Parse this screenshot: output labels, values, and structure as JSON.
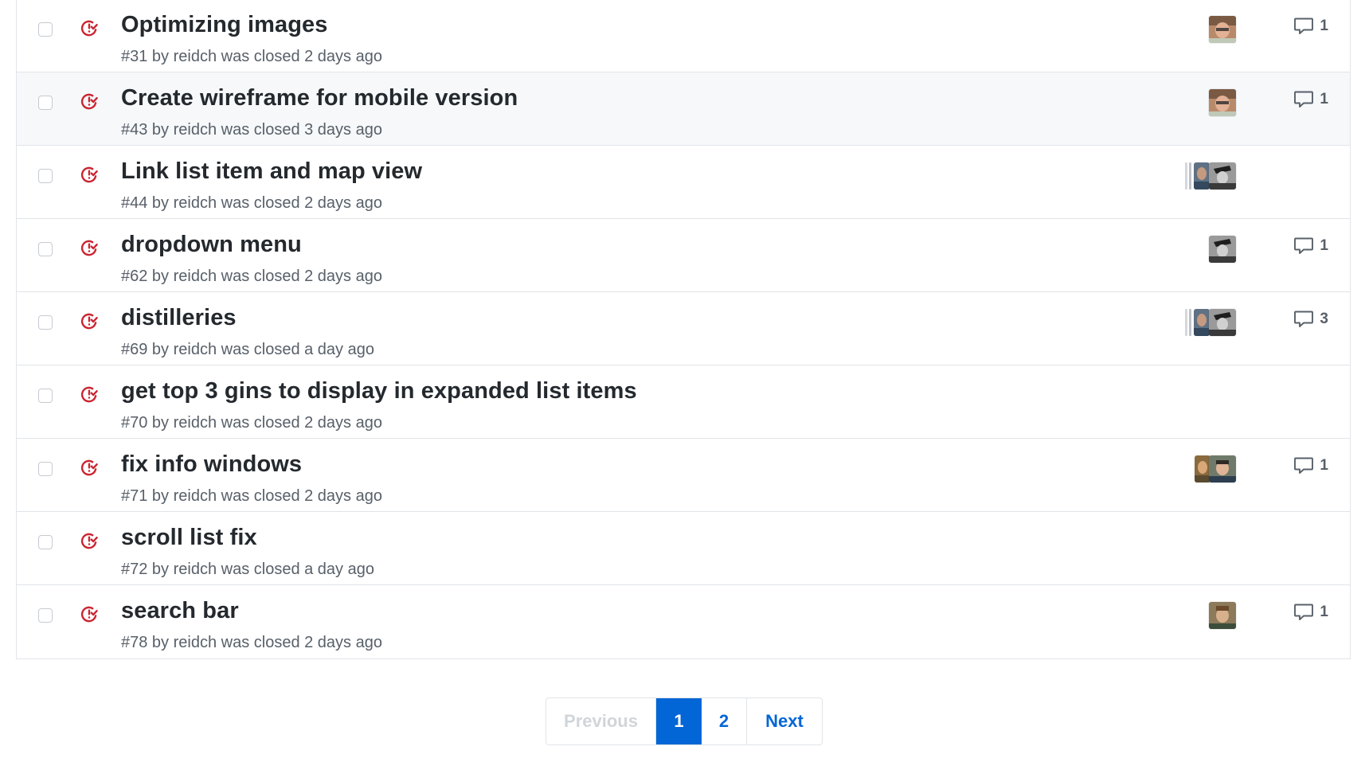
{
  "issues": [
    {
      "title": "Optimizing images",
      "meta": "#31 by reidch was closed 2 days ago",
      "comments": "1"
    },
    {
      "title": "Create wireframe for mobile version",
      "meta": "#43 by reidch was closed 3 days ago",
      "comments": "1"
    },
    {
      "title": "Link list item and map view",
      "meta": "#44 by reidch was closed 2 days ago",
      "comments": ""
    },
    {
      "title": "dropdown menu",
      "meta": "#62 by reidch was closed 2 days ago",
      "comments": "1"
    },
    {
      "title": "distilleries",
      "meta": "#69 by reidch was closed a day ago",
      "comments": "3"
    },
    {
      "title": "get top 3 gins to display in expanded list items",
      "meta": "#70 by reidch was closed 2 days ago",
      "comments": ""
    },
    {
      "title": "fix info windows",
      "meta": "#71 by reidch was closed 2 days ago",
      "comments": "1"
    },
    {
      "title": "scroll list fix",
      "meta": "#72 by reidch was closed a day ago",
      "comments": ""
    },
    {
      "title": "search bar",
      "meta": "#78 by reidch was closed 2 days ago",
      "comments": "1"
    }
  ],
  "pagination": {
    "previous": "Previous",
    "current": "1",
    "page2": "2",
    "next": "Next"
  },
  "colors": {
    "closed_icon": "#cb2431",
    "link": "#0366d6",
    "border": "#e1e4e8"
  },
  "icons": {
    "state": "issue-closed-icon",
    "comment": "comment-icon",
    "checkbox": "checkbox"
  }
}
